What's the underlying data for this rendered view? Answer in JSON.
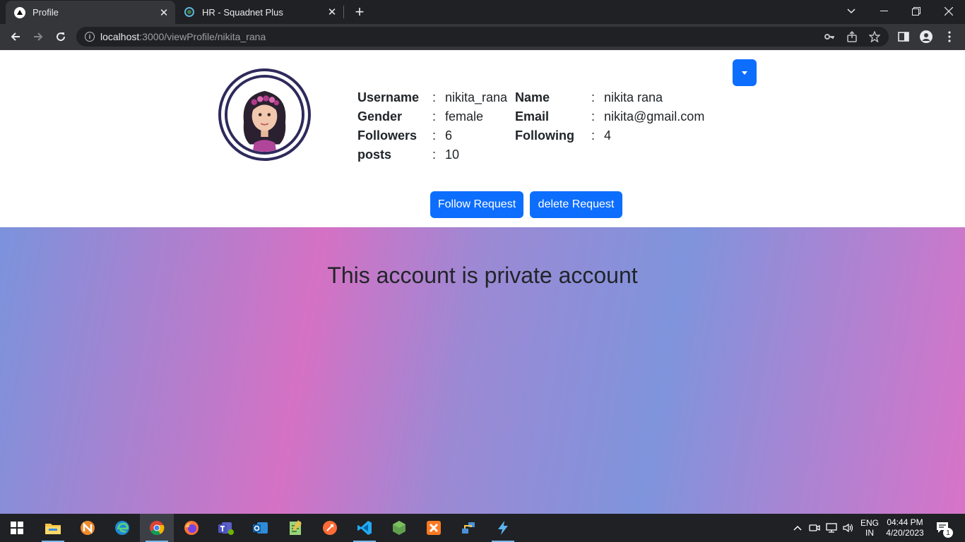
{
  "browser": {
    "tabs": [
      {
        "title": "Profile",
        "active": true
      },
      {
        "title": "HR - Squadnet Plus",
        "active": false
      }
    ],
    "url": {
      "host": "localhost",
      "path": ":3000/viewProfile/nikita_rana"
    }
  },
  "profile": {
    "fields": [
      {
        "label": "Username",
        "value": "nikita_rana"
      },
      {
        "label": "Name",
        "value": "nikita rana"
      },
      {
        "label": "Gender",
        "value": "female"
      },
      {
        "label": "Email",
        "value": "nikita@gmail.com"
      },
      {
        "label": "Followers",
        "value": "6"
      },
      {
        "label": "Following",
        "value": "4"
      },
      {
        "label": "posts",
        "value": "10"
      }
    ],
    "colon": ":",
    "buttons": {
      "follow": "Follow Request",
      "delete": "delete Request"
    },
    "private_message": "This account is private account"
  },
  "taskbar": {
    "apps": [
      "start-icon",
      "file-explorer-icon",
      "app-n-icon",
      "edge-icon",
      "chrome-icon",
      "firefox-icon",
      "teams-icon",
      "outlook-icon",
      "notepadpp-icon",
      "postman-icon",
      "vscode-icon",
      "nodejs-icon",
      "xampp-icon",
      "network-icon",
      "bolt-icon"
    ],
    "lang": {
      "line1": "ENG",
      "line2": "IN"
    },
    "time": "04:44 PM",
    "date": "4/20/2023",
    "notifications": "1"
  },
  "colors": {
    "accent": "#0d6efd",
    "avatar_ring": "#2e2a5c"
  }
}
